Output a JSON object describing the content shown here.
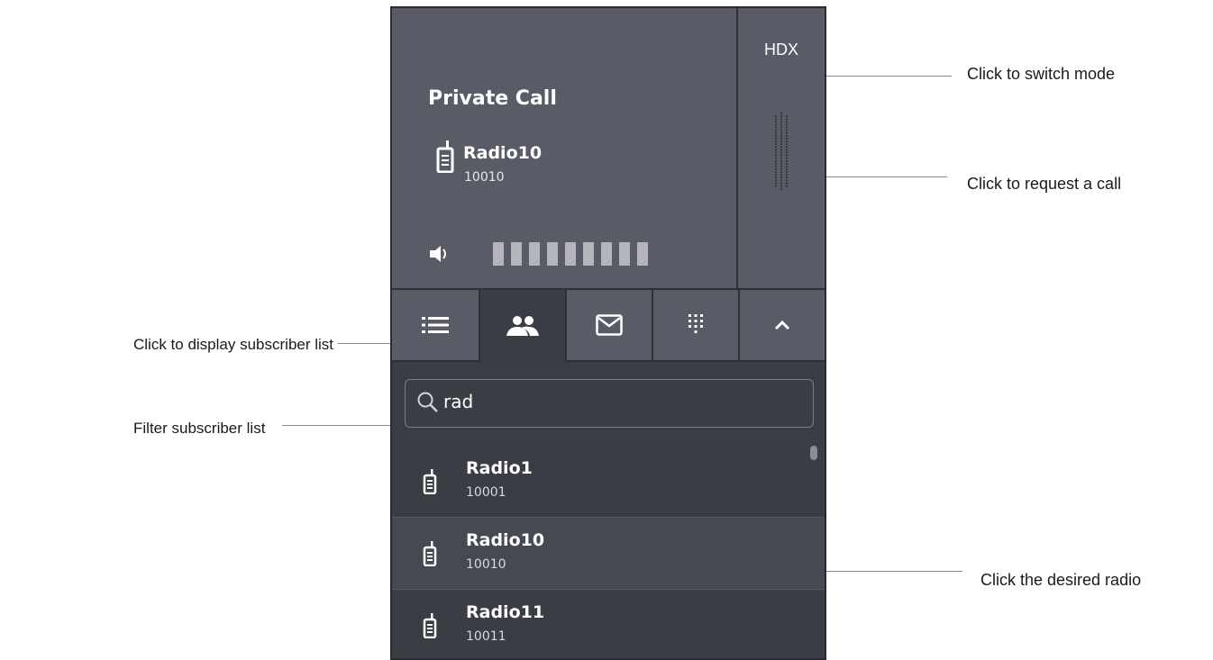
{
  "annotations": {
    "switch_mode": "Click to switch mode",
    "request_call": "Click to request a call",
    "display_subscriber_list": "Click to display subscriber list",
    "filter_subscriber_list": "Filter subscriber list",
    "desired_radio": "Click the desired radio"
  },
  "call": {
    "title": "Private Call",
    "radio_name": "Radio10",
    "radio_id": "10010",
    "volume_levels": 9
  },
  "side": {
    "mode_label": "HDX"
  },
  "tabs": [
    {
      "icon": "list-icon",
      "active": false
    },
    {
      "icon": "subscribers-icon",
      "active": true
    },
    {
      "icon": "mail-icon",
      "active": false
    },
    {
      "icon": "keypad-icon",
      "active": false
    },
    {
      "icon": "chevron-up-icon",
      "active": false
    }
  ],
  "search": {
    "value": "rad"
  },
  "subscribers": [
    {
      "name": "Radio1",
      "id": "10001"
    },
    {
      "name": "Radio10",
      "id": "10010"
    },
    {
      "name": "Radio11",
      "id": "10011"
    }
  ],
  "colors": {
    "panel_bg": "#595b67",
    "list_bg": "#3b3d45",
    "selected_row": "#464852",
    "text": "#ffffff"
  }
}
